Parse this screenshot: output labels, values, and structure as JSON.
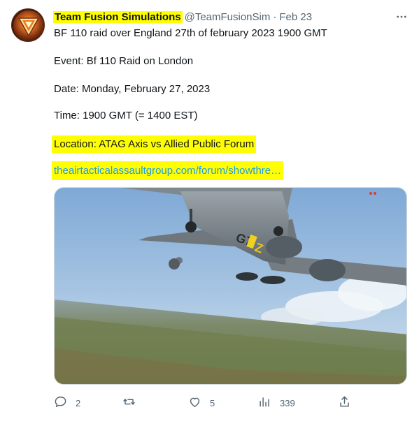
{
  "tweet": {
    "author_name": "Team Fusion Simulations",
    "handle": "@TeamFusionSim",
    "separator": "·",
    "date": "Feb 23",
    "lines": {
      "title": "BF 110 raid over England 27th of february 2023 1900 GMT",
      "event": "Event: Bf 110 Raid on London",
      "date": "Date: Monday, February 27, 2023",
      "time": "Time: 1900 GMT (= 1400 EST)",
      "location": "Location: ATAG Axis vs Allied Public Forum",
      "link": "theairtacticalassaultgroup.com/forum/showthre…"
    },
    "media": {
      "aircraft_code": "G7+FZ",
      "icon": "bf110-screenshot-image"
    }
  },
  "actions": {
    "reply_count": "2",
    "retweet_count": "",
    "like_count": "5",
    "views_count": "339"
  },
  "icons": {
    "more": "more-icon",
    "reply": "reply-icon",
    "retweet": "retweet-icon",
    "like": "like-icon",
    "views": "views-icon",
    "share": "share-icon"
  },
  "colors": {
    "highlight": "#ffff00",
    "link": "#1d9bf0",
    "muted": "#536471",
    "text": "#0f1419"
  }
}
